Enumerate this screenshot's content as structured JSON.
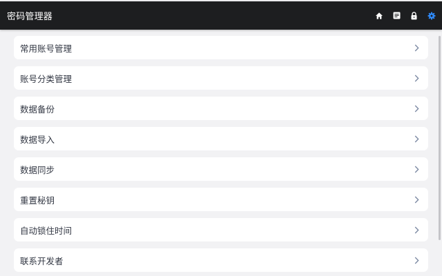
{
  "app": {
    "title": "密码管理器"
  },
  "toolbar": {
    "icons": [
      {
        "name": "home-icon",
        "color": "#ffffff"
      },
      {
        "name": "list-icon",
        "color": "#ffffff"
      },
      {
        "name": "lock-icon",
        "color": "#ffffff"
      },
      {
        "name": "settings-icon",
        "color": "#2f8cff",
        "active": true
      }
    ]
  },
  "settings": {
    "items": [
      {
        "label": "常用账号管理"
      },
      {
        "label": "账号分类管理"
      },
      {
        "label": "数据备份"
      },
      {
        "label": "数据导入"
      },
      {
        "label": "数据同步"
      },
      {
        "label": "重置秘钥"
      },
      {
        "label": "自动锁住时间"
      },
      {
        "label": "联系开发者"
      }
    ]
  },
  "colors": {
    "topbar_bg": "#1d1e20",
    "page_bg": "#f2f2f4",
    "active_accent": "#2f8cff",
    "chevron": "#7d8aa3"
  }
}
